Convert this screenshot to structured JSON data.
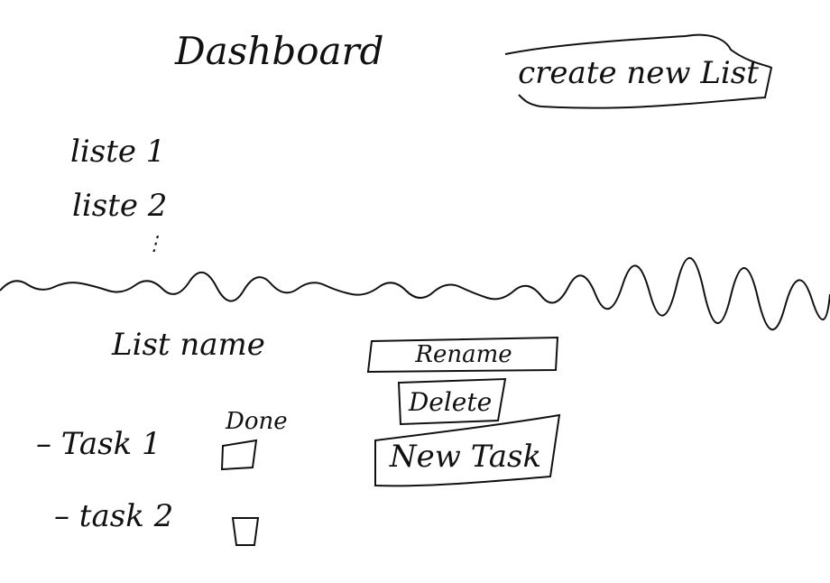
{
  "dashboard": {
    "title": "Dashboard",
    "create_button_label": "create new List",
    "lists": [
      "liste 1",
      "liste 2"
    ],
    "more_indicator": "⋮"
  },
  "list_detail": {
    "list_name": "List name",
    "rename_label": "Rename",
    "delete_label": "Delete",
    "new_task_label": "New Task",
    "done_column_label": "Done",
    "tasks": [
      {
        "label": "– Task 1",
        "done": false
      },
      {
        "label": "– task 2",
        "done": false
      }
    ]
  }
}
